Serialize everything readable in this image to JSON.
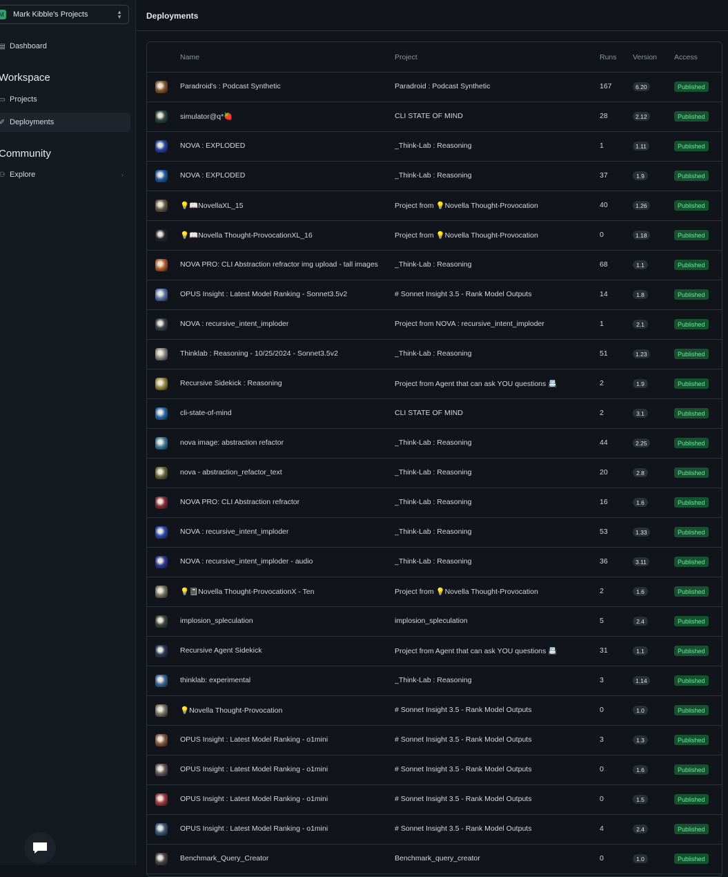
{
  "sidebar": {
    "project_selector": {
      "avatar": "M",
      "label": "Mark Kibble's Projects"
    },
    "dashboard": "Dashboard",
    "workspace_title": "Workspace",
    "projects": "Projects",
    "deployments": "Deployments",
    "community_title": "Community",
    "explore": "Explore"
  },
  "header": {
    "title": "Deployments"
  },
  "table": {
    "columns": {
      "name": "Name",
      "project": "Project",
      "runs": "Runs",
      "version": "Version",
      "access": "Access"
    },
    "rows": [
      {
        "name": "Paradroid's : Podcast Synthetic",
        "project": "Paradroid : Podcast Synthetic",
        "runs": "167",
        "version": "6.20",
        "access": "Published",
        "thumb": "#8a5a2b"
      },
      {
        "name": "simulator@q*🍓",
        "project": "CLI STATE OF MIND",
        "runs": "28",
        "version": "2.12",
        "access": "Published",
        "thumb": "#2e4a3a"
      },
      {
        "name": "NOVA : EXPLODED",
        "project": "_Think-Lab : Reasoning",
        "runs": "1",
        "version": "1.11",
        "access": "Published",
        "thumb": "#2346a8"
      },
      {
        "name": "NOVA : EXPLODED",
        "project": "_Think-Lab : Reasoning",
        "runs": "37",
        "version": "1.9",
        "access": "Published",
        "thumb": "#1f5fa8"
      },
      {
        "name": "💡📖NovellaXL_15",
        "project": "Project from 💡Novella Thought-Provocation",
        "runs": "40",
        "version": "1.26",
        "access": "Published",
        "thumb": "#6b5a48"
      },
      {
        "name": "💡📖Novella Thought-ProvocationXL_16",
        "project": "Project from 💡Novella Thought-Provocation",
        "runs": "0",
        "version": "1.18",
        "access": "Published",
        "thumb": "#20252c"
      },
      {
        "name": "NOVA PRO: CLI Abstraction refractor img upload - tall images",
        "project": "_Think-Lab : Reasoning",
        "runs": "68",
        "version": "1.1",
        "access": "Published",
        "thumb": "#b8602a"
      },
      {
        "name": "OPUS Insight : Latest Model Ranking - Sonnet3.5v2",
        "project": "# Sonnet Insight 3.5 - Rank Model Outputs",
        "runs": "14",
        "version": "1.8",
        "access": "Published",
        "thumb": "#5a78b0"
      },
      {
        "name": "NOVA : recursive_intent_imploder",
        "project": "Project from NOVA : recursive_intent_imploder",
        "runs": "1",
        "version": "2.1",
        "access": "Published",
        "thumb": "#3b4248"
      },
      {
        "name": "Thinklab : Reasoning - 10/25/2024 - Sonnet3.5v2",
        "project": "_Think-Lab : Reasoning",
        "runs": "51",
        "version": "1.23",
        "access": "Published",
        "thumb": "#8e8a80"
      },
      {
        "name": "Recursive Sidekick : Reasoning",
        "project": "Project from Agent that can ask YOU questions 📇",
        "runs": "2",
        "version": "1.9",
        "access": "Published",
        "thumb": "#a08a3c"
      },
      {
        "name": "cli-state-of-mind",
        "project": "CLI STATE OF MIND",
        "runs": "2",
        "version": "3.1",
        "access": "Published",
        "thumb": "#2a6ab0"
      },
      {
        "name": "nova image: abstraction refactor",
        "project": "_Think-Lab : Reasoning",
        "runs": "44",
        "version": "2.25",
        "access": "Published",
        "thumb": "#3d7fa0"
      },
      {
        "name": "nova - abstraction_refactor_text",
        "project": "_Think-Lab : Reasoning",
        "runs": "20",
        "version": "2.8",
        "access": "Published",
        "thumb": "#6a6a3a"
      },
      {
        "name": "NOVA PRO: CLI Abstraction refractor",
        "project": "_Think-Lab : Reasoning",
        "runs": "16",
        "version": "1.6",
        "access": "Published",
        "thumb": "#8a2a3a"
      },
      {
        "name": "NOVA : recursive_intent_imploder",
        "project": "_Think-Lab : Reasoning",
        "runs": "53",
        "version": "1.33",
        "access": "Published",
        "thumb": "#2a4ab0"
      },
      {
        "name": "NOVA : recursive_intent_imploder - audio",
        "project": "_Think-Lab : Reasoning",
        "runs": "36",
        "version": "3.11",
        "access": "Published",
        "thumb": "#2a3a9a"
      },
      {
        "name": "💡📓Novella Thought-ProvocationX - Ten",
        "project": "Project from 💡Novella Thought-Provocation",
        "runs": "2",
        "version": "1.6",
        "access": "Published",
        "thumb": "#7a7460"
      },
      {
        "name": "implosion_spleculation",
        "project": "implosion_spleculation",
        "runs": "5",
        "version": "2.4",
        "access": "Published",
        "thumb": "#3a4a3a"
      },
      {
        "name": "Recursive Agent Sidekick",
        "project": "Project from Agent that can ask YOU questions 📇",
        "runs": "31",
        "version": "1.1",
        "access": "Published",
        "thumb": "#2a3a5a"
      },
      {
        "name": "thinklab: experimental",
        "project": "_Think-Lab : Reasoning",
        "runs": "3",
        "version": "1.14",
        "access": "Published",
        "thumb": "#3a6aa0"
      },
      {
        "name": "💡Novella Thought-Provocation",
        "project": "# Sonnet Insight 3.5 - Rank Model Outputs",
        "runs": "0",
        "version": "1.0",
        "access": "Published",
        "thumb": "#7a7464"
      },
      {
        "name": "OPUS Insight : Latest Model Ranking - o1mini",
        "project": "# Sonnet Insight 3.5 - Rank Model Outputs",
        "runs": "3",
        "version": "1.3",
        "access": "Published",
        "thumb": "#8a5a3a"
      },
      {
        "name": "OPUS Insight : Latest Model Ranking - o1mini",
        "project": "# Sonnet Insight 3.5 - Rank Model Outputs",
        "runs": "0",
        "version": "1.6",
        "access": "Published",
        "thumb": "#6a5a5a"
      },
      {
        "name": "OPUS Insight : Latest Model Ranking - o1mini",
        "project": "# Sonnet Insight 3.5 - Rank Model Outputs",
        "runs": "0",
        "version": "1.5",
        "access": "Published",
        "thumb": "#a03a3a"
      },
      {
        "name": "OPUS Insight : Latest Model Ranking - o1mini",
        "project": "# Sonnet Insight 3.5 - Rank Model Outputs",
        "runs": "4",
        "version": "2.4",
        "access": "Published",
        "thumb": "#3a5a7a"
      },
      {
        "name": "Benchmark_Query_Creator",
        "project": "Benchmark_query_creator",
        "runs": "0",
        "version": "1.0",
        "access": "Published",
        "thumb": "#4a4448"
      }
    ]
  }
}
